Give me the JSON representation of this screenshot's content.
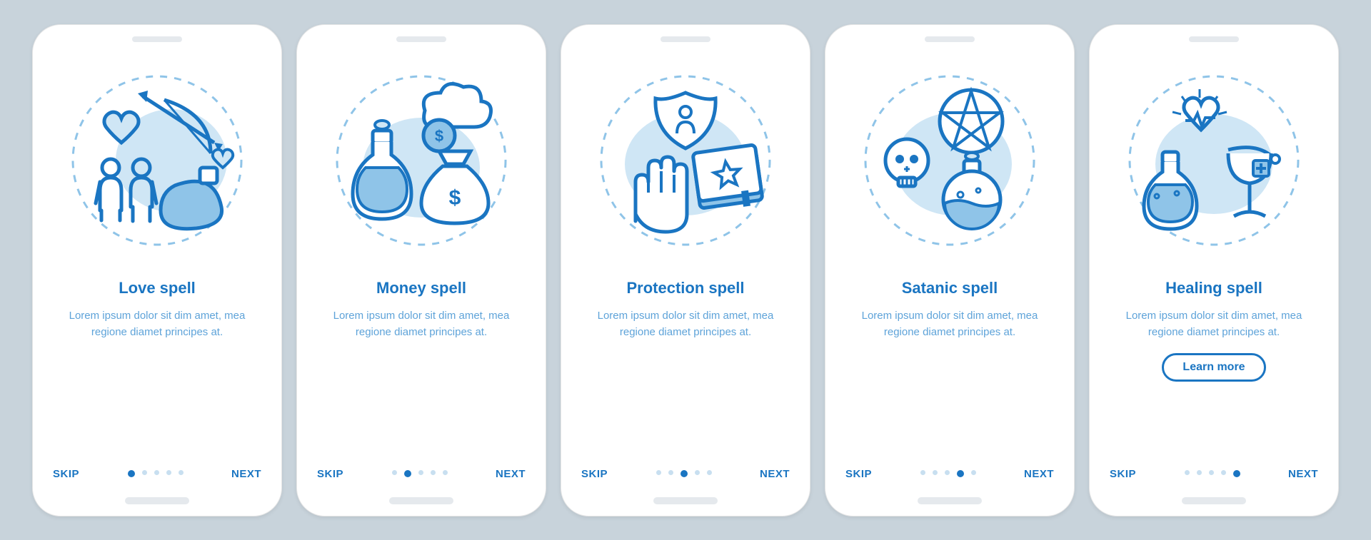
{
  "colors": {
    "primary": "#1a75c2",
    "light": "#8fc4e8",
    "fill": "#cfe6f5",
    "bg": "#c8d3db"
  },
  "common": {
    "skip": "SKIP",
    "next": "NEXT",
    "learn_more": "Learn more",
    "lorem": "Lorem ipsum dolor sit dim amet, mea regione diamet principes at."
  },
  "screens": [
    {
      "key": "love",
      "title": "Love spell",
      "icon": "love-spell-icon",
      "active_dot": 0,
      "learn_more": false
    },
    {
      "key": "money",
      "title": "Money spell",
      "icon": "money-spell-icon",
      "active_dot": 1,
      "learn_more": false
    },
    {
      "key": "protection",
      "title": "Protection spell",
      "icon": "protection-spell-icon",
      "active_dot": 2,
      "learn_more": false
    },
    {
      "key": "satanic",
      "title": "Satanic spell",
      "icon": "satanic-spell-icon",
      "active_dot": 3,
      "learn_more": false
    },
    {
      "key": "healing",
      "title": "Healing spell",
      "icon": "healing-spell-icon",
      "active_dot": 4,
      "learn_more": true
    }
  ]
}
